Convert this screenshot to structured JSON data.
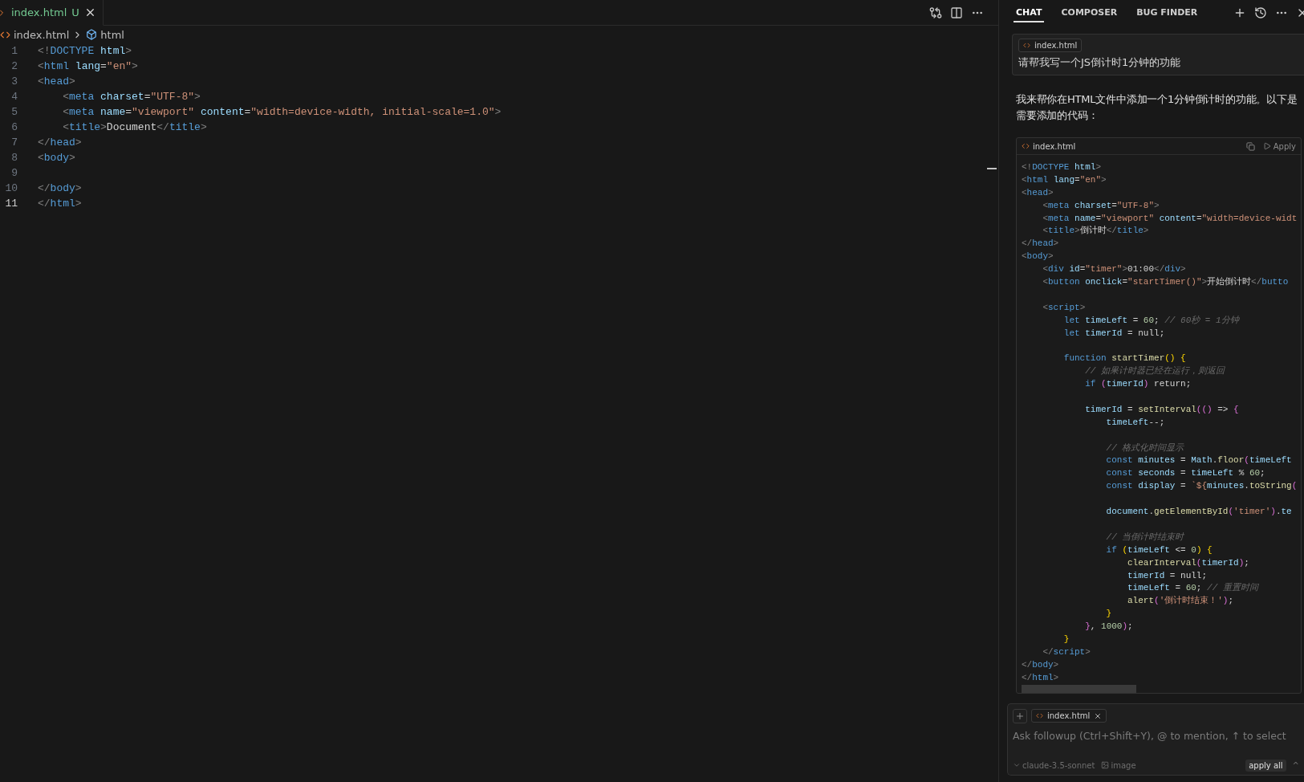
{
  "editor": {
    "tab": {
      "label": "index.html",
      "status": "U"
    },
    "breadcrumb": [
      "index.html",
      "html"
    ],
    "lines": [
      {
        "number": "1",
        "active": false,
        "kind": "code",
        "tokens": [
          {
            "kind": "p",
            "text": "<!"
          },
          {
            "kind": "t",
            "text": "DOCTYPE "
          },
          {
            "kind": "a",
            "text": "html"
          },
          {
            "kind": "p",
            "text": ">"
          }
        ]
      },
      {
        "number": "2",
        "active": false,
        "kind": "code",
        "tokens": [
          {
            "kind": "p",
            "text": "<"
          },
          {
            "kind": "t",
            "text": "html "
          },
          {
            "kind": "a",
            "text": "lang"
          },
          {
            "kind": "x",
            "text": "="
          },
          {
            "kind": "s",
            "text": "\"en\""
          },
          {
            "kind": "p",
            "text": ">"
          }
        ]
      },
      {
        "number": "3",
        "active": false,
        "kind": "code",
        "tokens": [
          {
            "kind": "p",
            "text": "<"
          },
          {
            "kind": "t",
            "text": "head"
          },
          {
            "kind": "p",
            "text": ">"
          }
        ]
      },
      {
        "number": "4",
        "active": false,
        "kind": "code",
        "tokens": [
          {
            "kind": "p",
            "text": "    <"
          },
          {
            "kind": "t",
            "text": "meta "
          },
          {
            "kind": "a",
            "text": "charset"
          },
          {
            "kind": "x",
            "text": "="
          },
          {
            "kind": "s",
            "text": "\"UTF-8\""
          },
          {
            "kind": "p",
            "text": ">"
          }
        ]
      },
      {
        "number": "5",
        "active": false,
        "kind": "code",
        "tokens": [
          {
            "kind": "p",
            "text": "    <"
          },
          {
            "kind": "t",
            "text": "meta "
          },
          {
            "kind": "a",
            "text": "name"
          },
          {
            "kind": "x",
            "text": "="
          },
          {
            "kind": "s",
            "text": "\"viewport\" "
          },
          {
            "kind": "a",
            "text": "content"
          },
          {
            "kind": "x",
            "text": "="
          },
          {
            "kind": "s",
            "text": "\"width=device-width, initial-scale=1.0\""
          },
          {
            "kind": "p",
            "text": ">"
          }
        ]
      },
      {
        "number": "6",
        "active": false,
        "kind": "code",
        "tokens": [
          {
            "kind": "p",
            "text": "    <"
          },
          {
            "kind": "t",
            "text": "title"
          },
          {
            "kind": "p",
            "text": ">"
          },
          {
            "kind": "x",
            "text": "Document"
          },
          {
            "kind": "p",
            "text": "</"
          },
          {
            "kind": "t",
            "text": "title"
          },
          {
            "kind": "p",
            "text": ">"
          }
        ]
      },
      {
        "number": "7",
        "active": false,
        "kind": "code",
        "tokens": [
          {
            "kind": "p",
            "text": "</"
          },
          {
            "kind": "t",
            "text": "head"
          },
          {
            "kind": "p",
            "text": ">"
          }
        ]
      },
      {
        "number": "8",
        "active": false,
        "kind": "code",
        "tokens": [
          {
            "kind": "p",
            "text": "<"
          },
          {
            "kind": "t",
            "text": "body"
          },
          {
            "kind": "p",
            "text": ">"
          }
        ]
      },
      {
        "number": "9",
        "active": false,
        "kind": "blank"
      },
      {
        "number": "10",
        "active": false,
        "kind": "code",
        "tokens": [
          {
            "kind": "p",
            "text": "</"
          },
          {
            "kind": "t",
            "text": "body"
          },
          {
            "kind": "p",
            "text": ">"
          }
        ]
      },
      {
        "number": "11",
        "active": true,
        "kind": "code",
        "tokens": [
          {
            "kind": "p",
            "text": "</"
          },
          {
            "kind": "t",
            "text": "html"
          },
          {
            "kind": "p",
            "text": ">"
          }
        ]
      }
    ]
  },
  "chat": {
    "tabs": [
      {
        "label": "CHAT",
        "selected": true
      },
      {
        "label": "COMPOSER",
        "selected": false
      },
      {
        "label": "BUG FINDER",
        "selected": false
      }
    ],
    "message": {
      "file": "index.html",
      "text": "请帮我写一个JS倒计时1分钟的功能"
    },
    "reply": "我来帮你在HTML文件中添加一个1分钟倒计时的功能。以下是需要添加的代码：",
    "code_block": {
      "file": "index.html",
      "action": "Apply",
      "lines": [
        {
          "kind": "code",
          "tokens": [
            {
              "kind": "p",
              "text": "<!"
            },
            {
              "kind": "t",
              "text": "DOCTYPE "
            },
            {
              "kind": "a",
              "text": "html"
            },
            {
              "kind": "p",
              "text": ">"
            }
          ]
        },
        {
          "kind": "code",
          "tokens": [
            {
              "kind": "p",
              "text": "<"
            },
            {
              "kind": "t",
              "text": "html "
            },
            {
              "kind": "a",
              "text": "lang"
            },
            {
              "kind": "x",
              "text": "="
            },
            {
              "kind": "s",
              "text": "\"en\""
            },
            {
              "kind": "p",
              "text": ">"
            }
          ]
        },
        {
          "kind": "code",
          "tokens": [
            {
              "kind": "p",
              "text": "<"
            },
            {
              "kind": "t",
              "text": "head"
            },
            {
              "kind": "p",
              "text": ">"
            }
          ]
        },
        {
          "kind": "code",
          "tokens": [
            {
              "kind": "p",
              "text": "    <"
            },
            {
              "kind": "t",
              "text": "meta "
            },
            {
              "kind": "a",
              "text": "charset"
            },
            {
              "kind": "x",
              "text": "="
            },
            {
              "kind": "s",
              "text": "\"UTF-8\""
            },
            {
              "kind": "p",
              "text": ">"
            }
          ]
        },
        {
          "kind": "code",
          "tokens": [
            {
              "kind": "p",
              "text": "    <"
            },
            {
              "kind": "t",
              "text": "meta "
            },
            {
              "kind": "a",
              "text": "name"
            },
            {
              "kind": "x",
              "text": "="
            },
            {
              "kind": "s",
              "text": "\"viewport\" "
            },
            {
              "kind": "a",
              "text": "content"
            },
            {
              "kind": "x",
              "text": "="
            },
            {
              "kind": "s",
              "text": "\"width=device-widt"
            }
          ]
        },
        {
          "kind": "code",
          "tokens": [
            {
              "kind": "p",
              "text": "    <"
            },
            {
              "kind": "t",
              "text": "title"
            },
            {
              "kind": "p",
              "text": ">"
            },
            {
              "kind": "x",
              "text": "倒计时"
            },
            {
              "kind": "p",
              "text": "</"
            },
            {
              "kind": "t",
              "text": "title"
            },
            {
              "kind": "p",
              "text": ">"
            }
          ]
        },
        {
          "kind": "code",
          "tokens": [
            {
              "kind": "p",
              "text": "</"
            },
            {
              "kind": "t",
              "text": "head"
            },
            {
              "kind": "p",
              "text": ">"
            }
          ]
        },
        {
          "kind": "code",
          "tokens": [
            {
              "kind": "p",
              "text": "<"
            },
            {
              "kind": "t",
              "text": "body"
            },
            {
              "kind": "p",
              "text": ">"
            }
          ]
        },
        {
          "kind": "code",
          "tokens": [
            {
              "kind": "p",
              "text": "    <"
            },
            {
              "kind": "t",
              "text": "div "
            },
            {
              "kind": "a",
              "text": "id"
            },
            {
              "kind": "x",
              "text": "="
            },
            {
              "kind": "s",
              "text": "\"timer\""
            },
            {
              "kind": "p",
              "text": ">"
            },
            {
              "kind": "x",
              "text": "01:00"
            },
            {
              "kind": "p",
              "text": "</"
            },
            {
              "kind": "t",
              "text": "div"
            },
            {
              "kind": "p",
              "text": ">"
            }
          ]
        },
        {
          "kind": "code",
          "tokens": [
            {
              "kind": "p",
              "text": "    <"
            },
            {
              "kind": "t",
              "text": "button "
            },
            {
              "kind": "a",
              "text": "onclick"
            },
            {
              "kind": "x",
              "text": "="
            },
            {
              "kind": "s",
              "text": "\"startTimer()\""
            },
            {
              "kind": "p",
              "text": ">"
            },
            {
              "kind": "x",
              "text": "开始倒计时"
            },
            {
              "kind": "p",
              "text": "</"
            },
            {
              "kind": "t",
              "text": "butto"
            }
          ]
        },
        {
          "kind": "blank"
        },
        {
          "kind": "code",
          "tokens": [
            {
              "kind": "p",
              "text": "    <"
            },
            {
              "kind": "t",
              "text": "script"
            },
            {
              "kind": "p",
              "text": ">"
            }
          ]
        },
        {
          "kind": "code",
          "tokens": [
            {
              "kind": "k",
              "text": "        let "
            },
            {
              "kind": "v",
              "text": "timeLeft "
            },
            {
              "kind": "x",
              "text": "= "
            },
            {
              "kind": "n",
              "text": "60"
            },
            {
              "kind": "x",
              "text": "; "
            },
            {
              "kind": "c",
              "text": "// 60秒 = 1分钟"
            }
          ]
        },
        {
          "kind": "code",
          "tokens": [
            {
              "kind": "k",
              "text": "        let "
            },
            {
              "kind": "v",
              "text": "timerId "
            },
            {
              "kind": "x",
              "text": "= null;"
            }
          ]
        },
        {
          "kind": "blank"
        },
        {
          "kind": "code",
          "tokens": [
            {
              "kind": "k",
              "text": "        function "
            },
            {
              "kind": "f",
              "text": "startTimer"
            },
            {
              "kind": "b",
              "text": "() {"
            }
          ]
        },
        {
          "kind": "code",
          "tokens": [
            {
              "kind": "c",
              "text": "            // 如果计时器已经在运行，则返回"
            }
          ]
        },
        {
          "kind": "code",
          "tokens": [
            {
              "kind": "k",
              "text": "            if "
            },
            {
              "kind": "m",
              "text": "("
            },
            {
              "kind": "v",
              "text": "timerId"
            },
            {
              "kind": "m",
              "text": ") "
            },
            {
              "kind": "x",
              "text": "return;"
            }
          ]
        },
        {
          "kind": "blank"
        },
        {
          "kind": "code",
          "tokens": [
            {
              "kind": "v",
              "text": "            timerId "
            },
            {
              "kind": "x",
              "text": "= "
            },
            {
              "kind": "f",
              "text": "setInterval"
            },
            {
              "kind": "m",
              "text": "(() "
            },
            {
              "kind": "x",
              "text": "=> "
            },
            {
              "kind": "m",
              "text": "{"
            }
          ]
        },
        {
          "kind": "code",
          "tokens": [
            {
              "kind": "v",
              "text": "                timeLeft"
            },
            {
              "kind": "x",
              "text": "--;"
            }
          ]
        },
        {
          "kind": "blank"
        },
        {
          "kind": "code",
          "tokens": [
            {
              "kind": "c",
              "text": "                // 格式化时间显示"
            }
          ]
        },
        {
          "kind": "code",
          "tokens": [
            {
              "kind": "k",
              "text": "                const "
            },
            {
              "kind": "v",
              "text": "minutes "
            },
            {
              "kind": "x",
              "text": "= "
            },
            {
              "kind": "v",
              "text": "Math"
            },
            {
              "kind": "x",
              "text": "."
            },
            {
              "kind": "f",
              "text": "floor"
            },
            {
              "kind": "m",
              "text": "("
            },
            {
              "kind": "v",
              "text": "timeLeft"
            }
          ]
        },
        {
          "kind": "code",
          "tokens": [
            {
              "kind": "k",
              "text": "                const "
            },
            {
              "kind": "v",
              "text": "seconds "
            },
            {
              "kind": "x",
              "text": "= "
            },
            {
              "kind": "v",
              "text": "timeLeft "
            },
            {
              "kind": "x",
              "text": "% "
            },
            {
              "kind": "n",
              "text": "60"
            },
            {
              "kind": "x",
              "text": ";"
            }
          ]
        },
        {
          "kind": "code",
          "tokens": [
            {
              "kind": "k",
              "text": "                const "
            },
            {
              "kind": "v",
              "text": "display "
            },
            {
              "kind": "x",
              "text": "= "
            },
            {
              "kind": "s",
              "text": "`${"
            },
            {
              "kind": "v",
              "text": "minutes"
            },
            {
              "kind": "x",
              "text": "."
            },
            {
              "kind": "f",
              "text": "toString"
            },
            {
              "kind": "m",
              "text": "("
            }
          ]
        },
        {
          "kind": "blank"
        },
        {
          "kind": "code",
          "tokens": [
            {
              "kind": "v",
              "text": "                document"
            },
            {
              "kind": "x",
              "text": "."
            },
            {
              "kind": "f",
              "text": "getElementById"
            },
            {
              "kind": "m",
              "text": "("
            },
            {
              "kind": "s",
              "text": "'timer'"
            },
            {
              "kind": "m",
              "text": ")"
            },
            {
              "kind": "x",
              "text": "."
            },
            {
              "kind": "v",
              "text": "te"
            }
          ]
        },
        {
          "kind": "blank"
        },
        {
          "kind": "code",
          "tokens": [
            {
              "kind": "c",
              "text": "                // 当倒计时结束时"
            }
          ]
        },
        {
          "kind": "code",
          "tokens": [
            {
              "kind": "k",
              "text": "                if "
            },
            {
              "kind": "b",
              "text": "("
            },
            {
              "kind": "v",
              "text": "timeLeft "
            },
            {
              "kind": "x",
              "text": "<= "
            },
            {
              "kind": "n",
              "text": "0"
            },
            {
              "kind": "b",
              "text": ") {"
            }
          ]
        },
        {
          "kind": "code",
          "tokens": [
            {
              "kind": "f",
              "text": "                    clearInterval"
            },
            {
              "kind": "m",
              "text": "("
            },
            {
              "kind": "v",
              "text": "timerId"
            },
            {
              "kind": "m",
              "text": ")"
            },
            {
              "kind": "x",
              "text": ";"
            }
          ]
        },
        {
          "kind": "code",
          "tokens": [
            {
              "kind": "v",
              "text": "                    timerId "
            },
            {
              "kind": "x",
              "text": "= null;"
            }
          ]
        },
        {
          "kind": "code",
          "tokens": [
            {
              "kind": "v",
              "text": "                    timeLeft "
            },
            {
              "kind": "x",
              "text": "= "
            },
            {
              "kind": "n",
              "text": "60"
            },
            {
              "kind": "x",
              "text": "; "
            },
            {
              "kind": "c",
              "text": "// 重置时间"
            }
          ]
        },
        {
          "kind": "code",
          "tokens": [
            {
              "kind": "f",
              "text": "                    alert"
            },
            {
              "kind": "m",
              "text": "("
            },
            {
              "kind": "s",
              "text": "'倒计时结束！'"
            },
            {
              "kind": "m",
              "text": ")"
            },
            {
              "kind": "x",
              "text": ";"
            }
          ]
        },
        {
          "kind": "code",
          "tokens": [
            {
              "kind": "b",
              "text": "                }"
            }
          ]
        },
        {
          "kind": "code",
          "tokens": [
            {
              "kind": "m",
              "text": "            }"
            },
            {
              "kind": "x",
              "text": ", "
            },
            {
              "kind": "n",
              "text": "1000"
            },
            {
              "kind": "m",
              "text": ")"
            },
            {
              "kind": "x",
              "text": ";"
            }
          ]
        },
        {
          "kind": "code",
          "tokens": [
            {
              "kind": "b",
              "text": "        }"
            }
          ]
        },
        {
          "kind": "code",
          "tokens": [
            {
              "kind": "p",
              "text": "    </"
            },
            {
              "kind": "t",
              "text": "script"
            },
            {
              "kind": "p",
              "text": ">"
            }
          ]
        },
        {
          "kind": "code",
          "tokens": [
            {
              "kind": "p",
              "text": "</"
            },
            {
              "kind": "t",
              "text": "body"
            },
            {
              "kind": "p",
              "text": ">"
            }
          ]
        },
        {
          "kind": "code",
          "tokens": [
            {
              "kind": "p",
              "text": "</"
            },
            {
              "kind": "t",
              "text": "html"
            },
            {
              "kind": "p",
              "text": ">"
            }
          ]
        }
      ]
    },
    "composer": {
      "file": "index.html",
      "placeholder": "Ask followup (Ctrl+Shift+Y), @ to mention, ↑ to select",
      "model": "claude-3.5-sonnet",
      "image": "image",
      "apply_all": "apply all",
      "shortcut": "^"
    }
  }
}
